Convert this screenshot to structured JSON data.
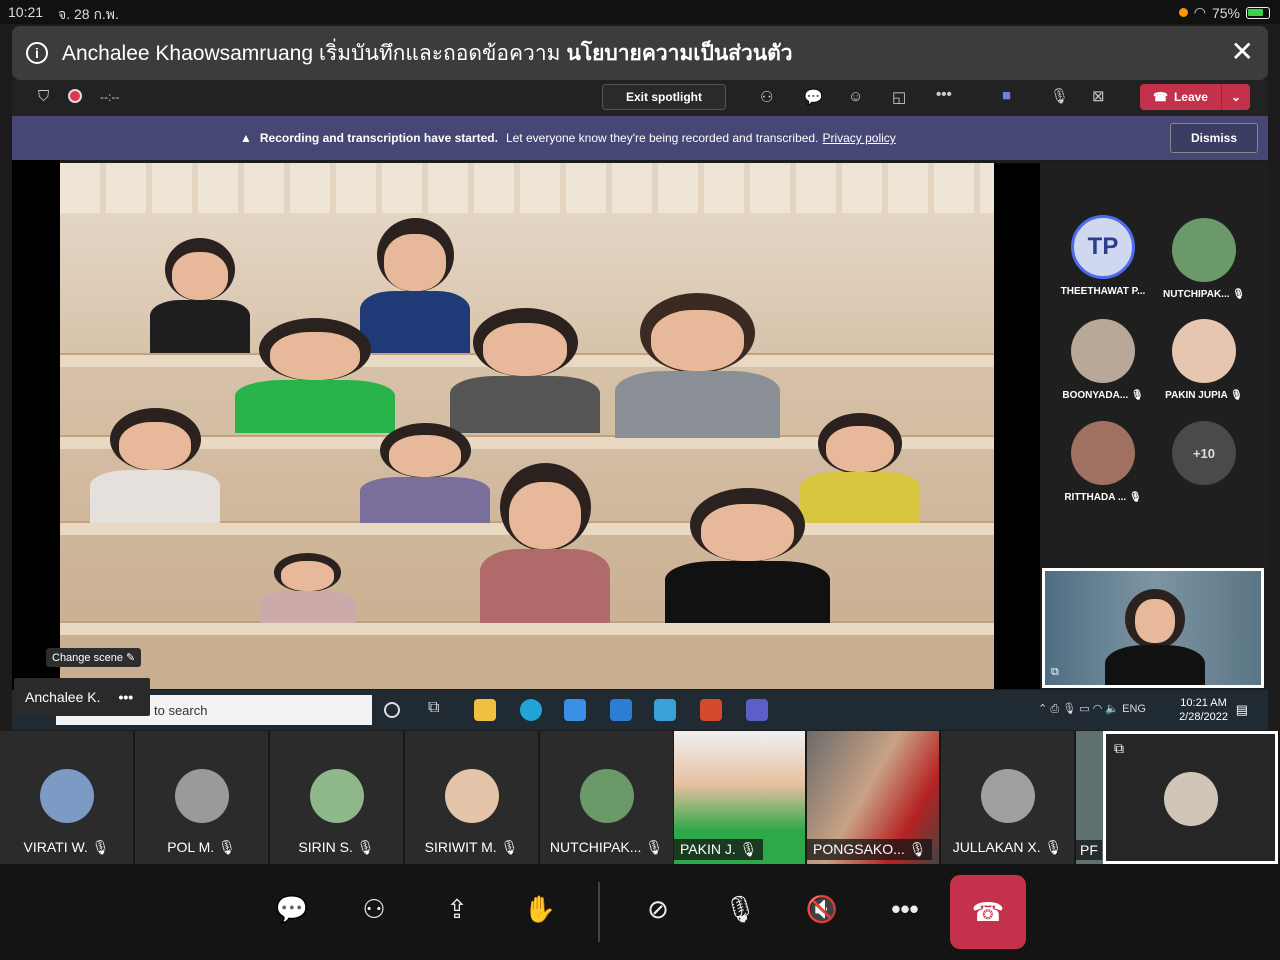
{
  "status_bar": {
    "time": "10:21",
    "date": "จ. 28 ก.พ.",
    "battery": "75%"
  },
  "notice": {
    "prefix": "Anchalee Khaowsamruang เริ่มบันทึกและถอดข้อความ",
    "link": "นโยบายความเป็นส่วนตัว"
  },
  "meeting_bar": {
    "timer": "--:--",
    "exit_spotlight": "Exit spotlight",
    "leave": "Leave"
  },
  "recording_banner": {
    "bold": "Recording and transcription have started.",
    "text": "Let everyone know they're being recorded and transcribed.",
    "link": "Privacy policy",
    "dismiss": "Dismiss"
  },
  "stage": {
    "change_scene": "Change scene",
    "presenter_label": "Anchalee K.",
    "more": "•••"
  },
  "taskbar": {
    "search_placeholder": "to search",
    "lang": "ENG",
    "clock_time": "10:21 AM",
    "clock_date": "2/28/2022"
  },
  "participants_panel": [
    {
      "initials": "TP",
      "label": "THEETHAWAT P..."
    },
    {
      "label": "NUTCHIPAK..."
    },
    {
      "label": "BOONYADA..."
    },
    {
      "label": "PAKIN JUPIA"
    },
    {
      "label": "RITTHADA ..."
    },
    {
      "label": "+10"
    }
  ],
  "strip": [
    {
      "name": "VIRATI W."
    },
    {
      "name": "POL M."
    },
    {
      "name": "SIRIN S."
    },
    {
      "name": "SIRIWIT M."
    },
    {
      "name": "NUTCHIPAK..."
    },
    {
      "name": "PAKIN J."
    },
    {
      "name": "PONGSAKO..."
    },
    {
      "name": "JULLAKAN X."
    },
    {
      "name": "PF"
    }
  ],
  "colors": {
    "teams_purple": "#464775",
    "leave_red": "#c4314b",
    "accent": "#4f6bed"
  }
}
